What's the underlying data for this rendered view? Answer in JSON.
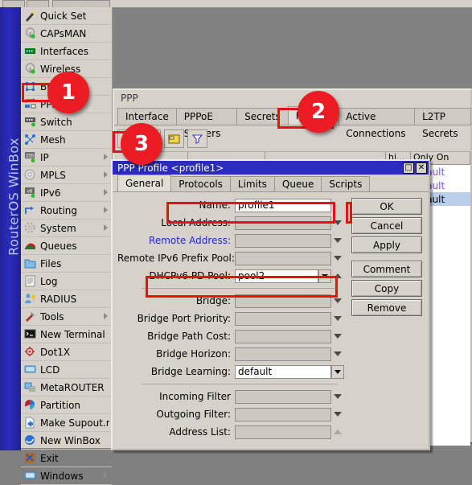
{
  "app": {
    "rail_text": "RouterOS WinBox"
  },
  "sidebar": {
    "items": [
      {
        "label": "Quick Set",
        "icon": "wand-icon",
        "submenu": false
      },
      {
        "label": "CAPsMAN",
        "icon": "capsman-icon",
        "submenu": false
      },
      {
        "label": "Interfaces",
        "icon": "interfaces-icon",
        "submenu": false
      },
      {
        "label": "Wireless",
        "icon": "wireless-icon",
        "submenu": false
      },
      {
        "label": "Bridge",
        "icon": "bridge-icon",
        "submenu": false
      },
      {
        "label": "PPP",
        "icon": "ppp-icon",
        "submenu": false
      },
      {
        "label": "Switch",
        "icon": "switch-icon",
        "submenu": false
      },
      {
        "label": "Mesh",
        "icon": "mesh-icon",
        "submenu": false
      },
      {
        "label": "IP",
        "icon": "ip-icon",
        "submenu": true
      },
      {
        "label": "MPLS",
        "icon": "mpls-icon",
        "submenu": true
      },
      {
        "label": "IPv6",
        "icon": "ipv6-icon",
        "submenu": true
      },
      {
        "label": "Routing",
        "icon": "routing-icon",
        "submenu": true
      },
      {
        "label": "System",
        "icon": "system-icon",
        "submenu": true
      },
      {
        "label": "Queues",
        "icon": "queues-icon",
        "submenu": false
      },
      {
        "label": "Files",
        "icon": "files-icon",
        "submenu": false
      },
      {
        "label": "Log",
        "icon": "log-icon",
        "submenu": false
      },
      {
        "label": "RADIUS",
        "icon": "radius-icon",
        "submenu": false
      },
      {
        "label": "Tools",
        "icon": "tools-icon",
        "submenu": true
      },
      {
        "label": "New Terminal",
        "icon": "terminal-icon",
        "submenu": false
      },
      {
        "label": "Dot1X",
        "icon": "dot1x-icon",
        "submenu": false
      },
      {
        "label": "LCD",
        "icon": "lcd-icon",
        "submenu": false
      },
      {
        "label": "MetaROUTER",
        "icon": "metarouter-icon",
        "submenu": false
      },
      {
        "label": "Partition",
        "icon": "partition-icon",
        "submenu": false
      },
      {
        "label": "Make Supout.rif",
        "icon": "supout-icon",
        "submenu": false
      },
      {
        "label": "New WinBox",
        "icon": "winbox-icon",
        "submenu": false
      },
      {
        "label": "Exit",
        "icon": "exit-icon",
        "submenu": false
      },
      {
        "label": "Windows",
        "icon": "windows-icon",
        "submenu": true
      }
    ]
  },
  "ppp_window": {
    "title": "PPP",
    "tabs": [
      {
        "label": "Interface",
        "selected": false
      },
      {
        "label": "PPPoE Servers",
        "selected": false
      },
      {
        "label": "Secrets",
        "selected": false
      },
      {
        "label": "Profiles",
        "selected": true
      },
      {
        "label": "Active Connections",
        "selected": false
      },
      {
        "label": "L2TP Secrets",
        "selected": false
      }
    ],
    "toolbar": [
      {
        "name": "add-button",
        "label": "+"
      },
      {
        "name": "remove-button",
        "label": "-"
      },
      {
        "name": "folder-button",
        "label": ""
      },
      {
        "name": "filter-button",
        "label": ""
      }
    ],
    "list_headers": [
      "",
      "",
      "",
      "hi...",
      "Only On"
    ],
    "list_rows": [
      {
        "name": "default",
        "style": "purple"
      },
      {
        "name": "default",
        "style": "purple"
      },
      {
        "name": "default",
        "style": "selected"
      }
    ]
  },
  "dialog": {
    "title": "PPP Profile <profile1>",
    "window_buttons": [
      {
        "name": "maximize-button",
        "glyph": "□"
      },
      {
        "name": "close-button",
        "glyph": "✕"
      }
    ],
    "tabs": [
      {
        "label": "General",
        "selected": true
      },
      {
        "label": "Protocols",
        "selected": false
      },
      {
        "label": "Limits",
        "selected": false
      },
      {
        "label": "Queue",
        "selected": false
      },
      {
        "label": "Scripts",
        "selected": false
      }
    ],
    "fields": [
      {
        "label": "Name:",
        "value": "profile1",
        "control": "text",
        "white": true,
        "highlight": true
      },
      {
        "label": "Local Address:",
        "value": "",
        "control": "caret",
        "white": false
      },
      {
        "label": "Remote Address:",
        "value": "",
        "control": "caret",
        "white": false,
        "label_blue": true
      },
      {
        "label": "Remote IPv6 Prefix Pool:",
        "value": "",
        "control": "caret",
        "white": false
      },
      {
        "label": "DHCPv6 PD Pool:",
        "value": "pool2",
        "control": "spin-up",
        "white": true,
        "highlight": true
      },
      {
        "label": "Bridge:",
        "value": "",
        "control": "caret",
        "white": false,
        "before_sep": true
      },
      {
        "label": "Bridge Port Priority:",
        "value": "",
        "control": "caret",
        "white": false
      },
      {
        "label": "Bridge Path Cost:",
        "value": "",
        "control": "caret",
        "white": false
      },
      {
        "label": "Bridge Horizon:",
        "value": "",
        "control": "caret",
        "white": false
      },
      {
        "label": "Bridge Learning:",
        "value": "default",
        "control": "spin",
        "white": true
      },
      {
        "label": "Incoming Filter",
        "value": "",
        "control": "caret",
        "white": false,
        "before_sep": true
      },
      {
        "label": "Outgoing Filter:",
        "value": "",
        "control": "caret",
        "white": false
      },
      {
        "label": "Address List:",
        "value": "",
        "control": "up-dim",
        "white": false
      }
    ],
    "buttons": [
      {
        "label": "OK",
        "gap": false
      },
      {
        "label": "Cancel",
        "gap": false
      },
      {
        "label": "Apply",
        "gap": false
      },
      {
        "label": "Comment",
        "gap": true
      },
      {
        "label": "Copy",
        "gap": false
      },
      {
        "label": "Remove",
        "gap": false
      }
    ]
  },
  "annotations": {
    "markers": [
      {
        "number": "1",
        "target": "ppp-sidebar-item"
      },
      {
        "number": "2",
        "target": "profiles-tab"
      },
      {
        "number": "3",
        "target": "add-button"
      }
    ],
    "accent_color": "#ec1c24"
  }
}
